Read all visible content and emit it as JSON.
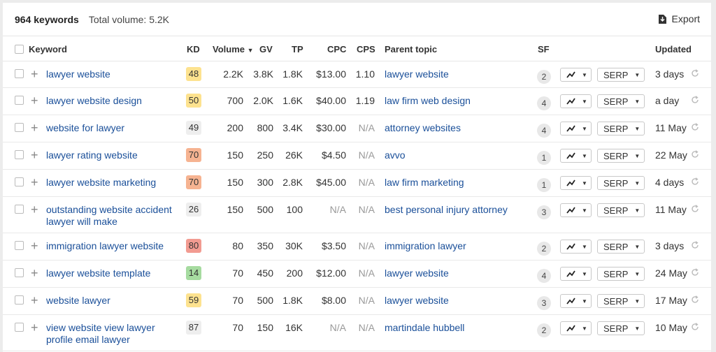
{
  "summary": {
    "keywords": "964 keywords",
    "total_volume": "Total volume: 5.2K"
  },
  "toolbar": {
    "export_label": "Export"
  },
  "columns": {
    "keyword": "Keyword",
    "kd": "KD",
    "volume": "Volume",
    "gv": "GV",
    "tp": "TP",
    "cpc": "CPC",
    "cps": "CPS",
    "parent_topic": "Parent topic",
    "sf": "SF",
    "updated": "Updated"
  },
  "kd_colors": {
    "green": "#a6dba0",
    "yellow": "#fde28f",
    "orange": "#f6b391",
    "red": "#f29b91",
    "gray": "#eeeeee"
  },
  "serp_label": "SERP",
  "rows": [
    {
      "keyword": "lawyer website",
      "kd": "48",
      "kd_color": "yellow",
      "volume": "2.2K",
      "gv": "3.8K",
      "tp": "1.8K",
      "cpc": "$13.00",
      "cps": "1.10",
      "parent": "lawyer website",
      "sf": "2",
      "updated": "3 days"
    },
    {
      "keyword": "lawyer website design",
      "kd": "50",
      "kd_color": "yellow",
      "volume": "700",
      "gv": "2.0K",
      "tp": "1.6K",
      "cpc": "$40.00",
      "cps": "1.19",
      "parent": "law firm web design",
      "sf": "4",
      "updated": "a day"
    },
    {
      "keyword": "website for lawyer",
      "kd": "49",
      "kd_color": "gray",
      "volume": "200",
      "gv": "800",
      "tp": "3.4K",
      "cpc": "$30.00",
      "cps": "N/A",
      "parent": "attorney websites",
      "sf": "4",
      "updated": "11 May"
    },
    {
      "keyword": "lawyer rating website",
      "kd": "70",
      "kd_color": "orange",
      "volume": "150",
      "gv": "250",
      "tp": "26K",
      "cpc": "$4.50",
      "cps": "N/A",
      "parent": "avvo",
      "sf": "1",
      "updated": "22 May"
    },
    {
      "keyword": "lawyer website marketing",
      "kd": "70",
      "kd_color": "orange",
      "volume": "150",
      "gv": "300",
      "tp": "2.8K",
      "cpc": "$45.00",
      "cps": "N/A",
      "parent": "law firm marketing",
      "sf": "1",
      "updated": "4 days"
    },
    {
      "keyword": "outstanding website accident lawyer will make",
      "kd": "26",
      "kd_color": "gray",
      "volume": "150",
      "gv": "500",
      "tp": "100",
      "cpc": "N/A",
      "cps": "N/A",
      "parent": "best personal injury attorney",
      "sf": "3",
      "updated": "11 May"
    },
    {
      "keyword": "immigration lawyer website",
      "kd": "80",
      "kd_color": "red",
      "volume": "80",
      "gv": "350",
      "tp": "30K",
      "cpc": "$3.50",
      "cps": "N/A",
      "parent": "immigration lawyer",
      "sf": "2",
      "updated": "3 days"
    },
    {
      "keyword": "lawyer website template",
      "kd": "14",
      "kd_color": "green",
      "volume": "70",
      "gv": "450",
      "tp": "200",
      "cpc": "$12.00",
      "cps": "N/A",
      "parent": "lawyer website",
      "sf": "4",
      "updated": "24 May"
    },
    {
      "keyword": "website lawyer",
      "kd": "59",
      "kd_color": "yellow",
      "volume": "70",
      "gv": "500",
      "tp": "1.8K",
      "cpc": "$8.00",
      "cps": "N/A",
      "parent": "lawyer website",
      "sf": "3",
      "updated": "17 May"
    },
    {
      "keyword": "view website view lawyer profile email lawyer",
      "kd": "87",
      "kd_color": "gray",
      "volume": "70",
      "gv": "150",
      "tp": "16K",
      "cpc": "N/A",
      "cps": "N/A",
      "parent": "martindale hubbell",
      "sf": "2",
      "updated": "10 May"
    }
  ]
}
